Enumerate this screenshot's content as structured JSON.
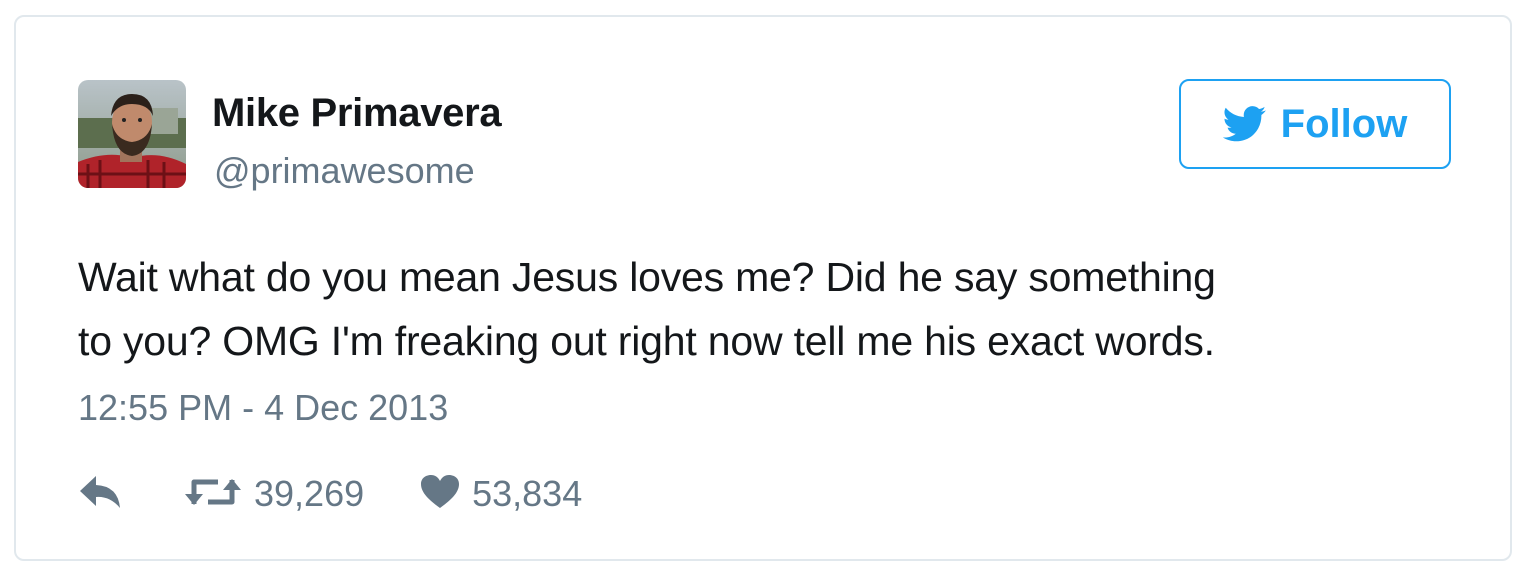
{
  "tweet": {
    "author": {
      "display_name": "Mike Primavera",
      "handle": "@primawesome",
      "avatar_icon": "profile-photo"
    },
    "follow_button": {
      "label": "Follow",
      "icon": "twitter-bird-icon",
      "accent_color": "#1da1f2"
    },
    "text_lines": [
      "Wait what do you mean Jesus loves me? Did he say something",
      "to you? OMG I'm freaking out right now tell me his exact words."
    ],
    "timestamp": "12:55 PM - 4 Dec 2013",
    "actions": {
      "reply_icon": "reply-icon",
      "retweet_icon": "retweet-icon",
      "retweet_count": "39,269",
      "like_icon": "heart-icon",
      "like_count": "53,834"
    }
  }
}
